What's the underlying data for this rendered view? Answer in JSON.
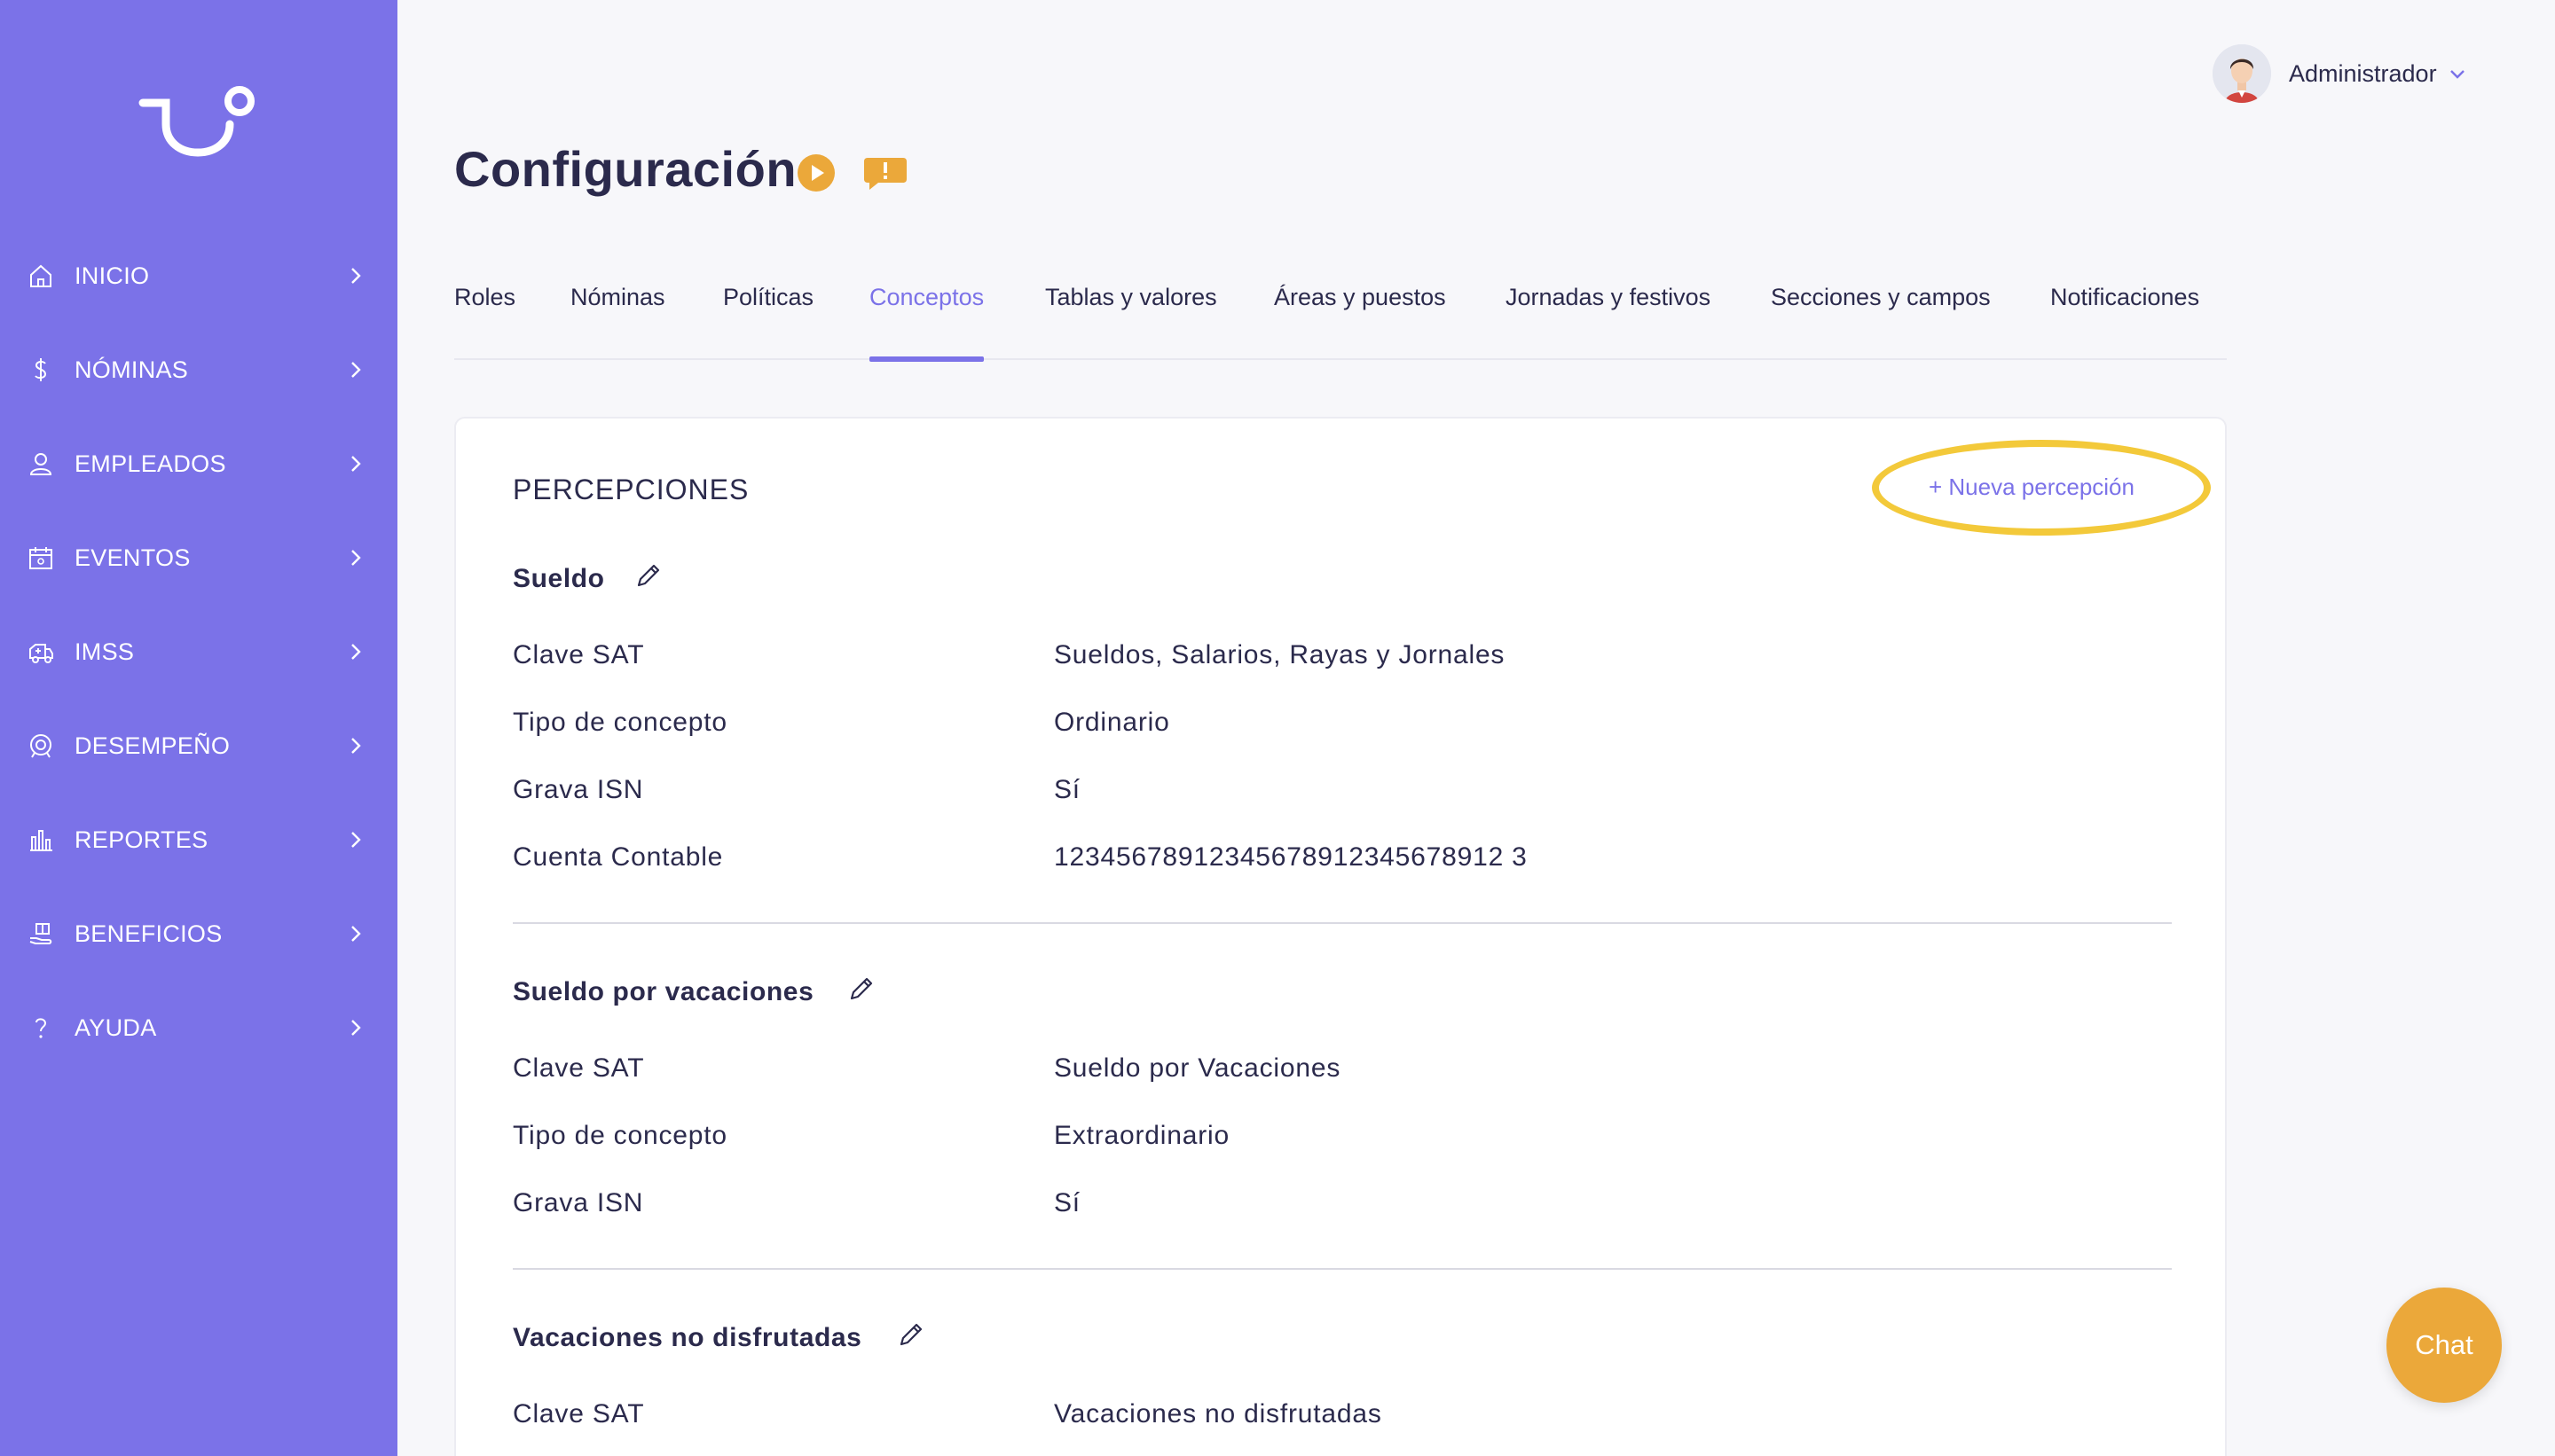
{
  "sidebar": {
    "items": [
      {
        "label": "INICIO",
        "icon": "home-icon"
      },
      {
        "label": "NÓMINAS",
        "icon": "dollar-icon"
      },
      {
        "label": "EMPLEADOS",
        "icon": "user-icon"
      },
      {
        "label": "EVENTOS",
        "icon": "calendar-icon"
      },
      {
        "label": "IMSS",
        "icon": "ambulance-icon"
      },
      {
        "label": "DESEMPEÑO",
        "icon": "performance-icon"
      },
      {
        "label": "REPORTES",
        "icon": "bar-chart-icon"
      },
      {
        "label": "BENEFICIOS",
        "icon": "gift-hand-icon"
      },
      {
        "label": "AYUDA",
        "icon": "question-icon"
      }
    ]
  },
  "header": {
    "user_name": "Administrador",
    "page_title": "Configuración"
  },
  "tabs": [
    {
      "label": "Roles"
    },
    {
      "label": "Nóminas"
    },
    {
      "label": "Políticas"
    },
    {
      "label": "Conceptos",
      "active": true
    },
    {
      "label": "Tablas y valores"
    },
    {
      "label": "Áreas y puestos"
    },
    {
      "label": "Jornadas y festivos"
    },
    {
      "label": "Secciones y campos"
    },
    {
      "label": "Notificaciones"
    }
  ],
  "card": {
    "title": "PERCEPCIONES",
    "new_button": "+ Nueva percepción",
    "concepts": [
      {
        "name": "Sueldo",
        "rows": [
          {
            "label": "Clave SAT",
            "value": "Sueldos, Salarios, Rayas y Jornales"
          },
          {
            "label": "Tipo de concepto",
            "value": "Ordinario"
          },
          {
            "label": "Grava ISN",
            "value": "Sí"
          },
          {
            "label": "Cuenta Contable",
            "value": "12345678912345678912345678912 3"
          }
        ]
      },
      {
        "name": "Sueldo por vacaciones",
        "rows": [
          {
            "label": "Clave SAT",
            "value": "Sueldo por Vacaciones"
          },
          {
            "label": "Tipo de concepto",
            "value": "Extraordinario"
          },
          {
            "label": "Grava ISN",
            "value": "Sí"
          }
        ]
      },
      {
        "name": "Vacaciones no disfrutadas",
        "rows": [
          {
            "label": "Clave SAT",
            "value": "Vacaciones no disfrutadas"
          }
        ]
      }
    ]
  },
  "chat": {
    "label": "Chat"
  },
  "colors": {
    "sidebar": "#7b72e8",
    "accent": "#7b72e8",
    "highlight": "#f3c93a",
    "chat": "#eba83a",
    "title_icons": "#eba83a"
  }
}
